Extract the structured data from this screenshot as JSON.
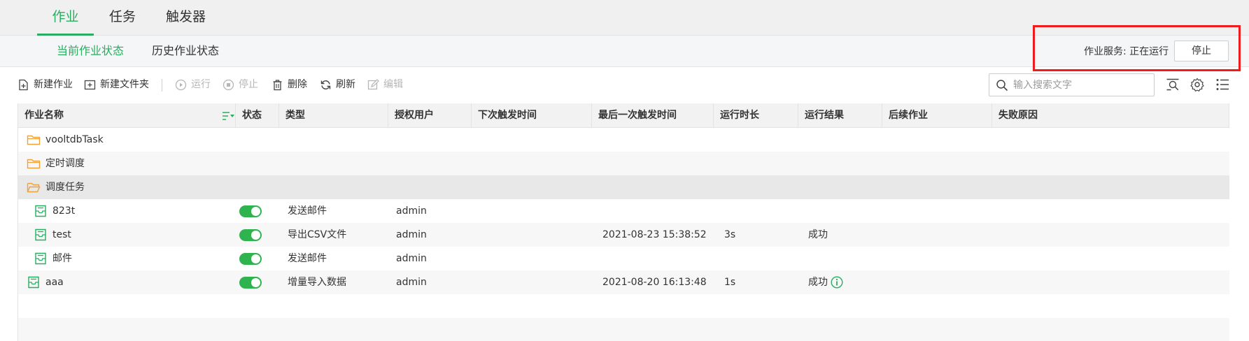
{
  "top_tabs": [
    "作业",
    "任务",
    "触发器"
  ],
  "sub_tabs": [
    "当前作业状态",
    "历史作业状态"
  ],
  "service": {
    "label": "作业服务: 正在运行",
    "stop_label": "停止"
  },
  "toolbar": {
    "new_job": "新建作业",
    "new_folder": "新建文件夹",
    "run": "运行",
    "stop": "停止",
    "delete": "删除",
    "refresh": "刷新",
    "edit": "编辑"
  },
  "search": {
    "placeholder": "输入搜索文字"
  },
  "columns": [
    "作业名称",
    "状态",
    "类型",
    "授权用户",
    "下次触发时间",
    "最后一次触发时间",
    "运行时长",
    "运行结果",
    "后续作业",
    "失败原因"
  ],
  "rows": [
    {
      "kind": "folder",
      "name": "vooltdbTask",
      "type": "",
      "user": "",
      "next": "",
      "last": "",
      "duration": "",
      "result": ""
    },
    {
      "kind": "folder",
      "name": "定时调度",
      "type": "",
      "user": "",
      "next": "",
      "last": "",
      "duration": "",
      "result": ""
    },
    {
      "kind": "folder",
      "name": "调度任务",
      "type": "",
      "user": "",
      "next": "",
      "last": "",
      "duration": "",
      "result": ""
    },
    {
      "kind": "job",
      "name": "823t",
      "enabled": true,
      "type": "发送邮件",
      "user": "admin",
      "next": "",
      "last": "",
      "duration": "",
      "result": ""
    },
    {
      "kind": "job",
      "name": "test",
      "enabled": true,
      "type": "导出CSV文件",
      "user": "admin",
      "next": "",
      "last": "2021-08-23 15:38:52",
      "duration": "3s",
      "result": "成功"
    },
    {
      "kind": "job",
      "name": "邮件",
      "enabled": true,
      "type": "发送邮件",
      "user": "admin",
      "next": "",
      "last": "",
      "duration": "",
      "result": ""
    },
    {
      "kind": "job",
      "name": "aaa",
      "enabled": true,
      "type": "增量导入数据",
      "user": "admin",
      "next": "",
      "last": "2021-08-20 16:13:48",
      "duration": "1s",
      "result": "成功"
    }
  ],
  "colors": {
    "accent": "#27ae60",
    "toggle_on": "#2eb34f",
    "folder": "#f0a23a",
    "highlight_box": "#ee1c1c"
  },
  "icons": {
    "folder": "folder-icon",
    "job": "job-icon",
    "info": "info-icon"
  }
}
